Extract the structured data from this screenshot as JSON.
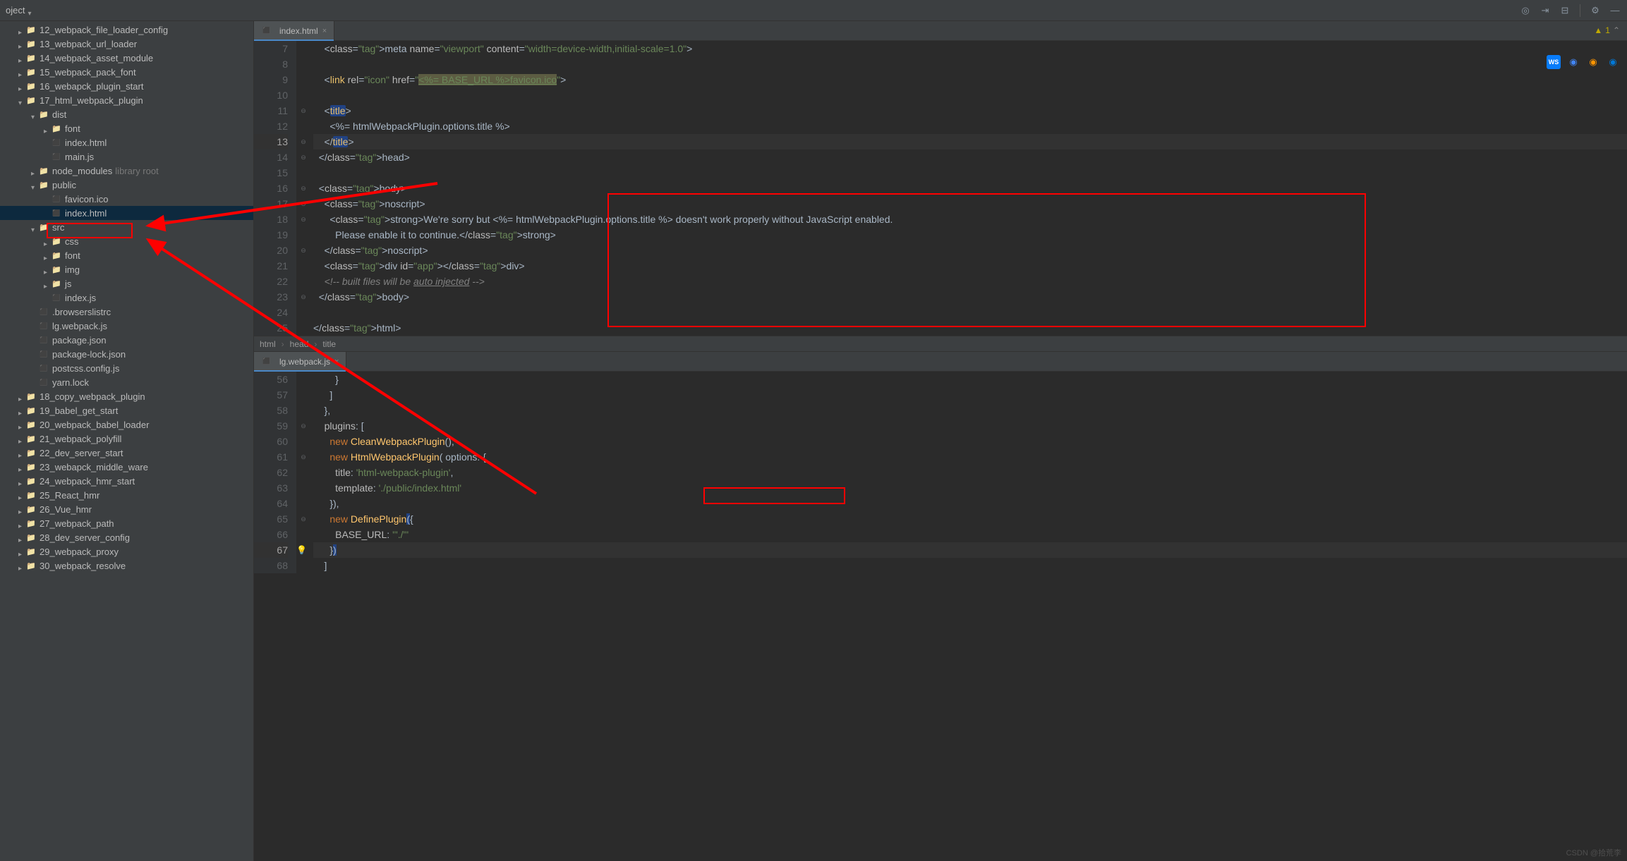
{
  "toolbar": {
    "title": "oject"
  },
  "tree": [
    {
      "d": 1,
      "ch": "r",
      "i": "folder",
      "t": "12_webpack_file_loader_config"
    },
    {
      "d": 1,
      "ch": "r",
      "i": "folder",
      "t": "13_webpack_url_loader"
    },
    {
      "d": 1,
      "ch": "r",
      "i": "folder",
      "t": "14_webpack_asset_module"
    },
    {
      "d": 1,
      "ch": "r",
      "i": "folder",
      "t": "15_webpack_pack_font"
    },
    {
      "d": 1,
      "ch": "r",
      "i": "folder",
      "t": "16_webapck_plugin_start"
    },
    {
      "d": 1,
      "ch": "d",
      "i": "folder",
      "t": "17_html_webpack_plugin"
    },
    {
      "d": 2,
      "ch": "d",
      "i": "folder",
      "t": "dist"
    },
    {
      "d": 3,
      "ch": "r",
      "i": "folder",
      "t": "font"
    },
    {
      "d": 3,
      "ch": "",
      "i": "file-html",
      "t": "index.html"
    },
    {
      "d": 3,
      "ch": "",
      "i": "file-js",
      "t": "main.js"
    },
    {
      "d": 2,
      "ch": "r",
      "i": "folder",
      "t": "node_modules",
      "hint": "library root"
    },
    {
      "d": 2,
      "ch": "d",
      "i": "folder",
      "t": "public"
    },
    {
      "d": 3,
      "ch": "",
      "i": "file-ico",
      "t": "favicon.ico"
    },
    {
      "d": 3,
      "ch": "",
      "i": "file-html",
      "t": "index.html",
      "sel": true
    },
    {
      "d": 2,
      "ch": "d",
      "i": "folder",
      "t": "src"
    },
    {
      "d": 3,
      "ch": "r",
      "i": "folder",
      "t": "css"
    },
    {
      "d": 3,
      "ch": "r",
      "i": "folder",
      "t": "font"
    },
    {
      "d": 3,
      "ch": "r",
      "i": "folder",
      "t": "img"
    },
    {
      "d": 3,
      "ch": "r",
      "i": "folder",
      "t": "js"
    },
    {
      "d": 3,
      "ch": "",
      "i": "file-js",
      "t": "index.js"
    },
    {
      "d": 2,
      "ch": "",
      "i": "file-generic",
      "t": ".browserslistrc"
    },
    {
      "d": 2,
      "ch": "",
      "i": "file-js",
      "t": "lg.webpack.js"
    },
    {
      "d": 2,
      "ch": "",
      "i": "file-json",
      "t": "package.json"
    },
    {
      "d": 2,
      "ch": "",
      "i": "file-json",
      "t": "package-lock.json"
    },
    {
      "d": 2,
      "ch": "",
      "i": "file-js",
      "t": "postcss.config.js"
    },
    {
      "d": 2,
      "ch": "",
      "i": "file-generic",
      "t": "yarn.lock"
    },
    {
      "d": 1,
      "ch": "r",
      "i": "folder",
      "t": "18_copy_webpack_plugin"
    },
    {
      "d": 1,
      "ch": "r",
      "i": "folder",
      "t": "19_babel_get_start"
    },
    {
      "d": 1,
      "ch": "r",
      "i": "folder",
      "t": "20_webpack_babel_loader"
    },
    {
      "d": 1,
      "ch": "r",
      "i": "folder",
      "t": "21_webpack_polyfill"
    },
    {
      "d": 1,
      "ch": "r",
      "i": "folder",
      "t": "22_dev_server_start"
    },
    {
      "d": 1,
      "ch": "r",
      "i": "folder",
      "t": "23_webapck_middle_ware"
    },
    {
      "d": 1,
      "ch": "r",
      "i": "folder",
      "t": "24_webpack_hmr_start"
    },
    {
      "d": 1,
      "ch": "r",
      "i": "folder",
      "t": "25_React_hmr"
    },
    {
      "d": 1,
      "ch": "r",
      "i": "folder",
      "t": "26_Vue_hmr"
    },
    {
      "d": 1,
      "ch": "r",
      "i": "folder",
      "t": "27_webpack_path"
    },
    {
      "d": 1,
      "ch": "r",
      "i": "folder",
      "t": "28_dev_server_config"
    },
    {
      "d": 1,
      "ch": "r",
      "i": "folder",
      "t": "29_webpack_proxy"
    },
    {
      "d": 1,
      "ch": "r",
      "i": "folder",
      "t": "30_webpack_resolve"
    }
  ],
  "tab1": {
    "label": "index.html"
  },
  "tab2": {
    "label": "lg.webpack.js"
  },
  "breadcrumb": [
    "html",
    "head",
    "title"
  ],
  "warn": {
    "count": "1"
  },
  "watermark": "CSDN @拾荒李",
  "e1": {
    "start": 7,
    "lines": [
      "    <meta name=\"viewport\" content=\"width=device-width,initial-scale=1.0\">",
      "",
      "    <link rel=\"icon\" href=\"<%= BASE_URL %>favicon.ico\">",
      "",
      "    <title>",
      "      <%= htmlWebpackPlugin.options.title %>",
      "    </title>",
      "  </head>",
      "",
      "  <body>",
      "    <noscript>",
      "      <strong>We're sorry but <%= htmlWebpackPlugin.options.title %> doesn't work properly without JavaScript enabled.",
      "        Please enable it to continue.</strong>",
      "    </noscript>",
      "    <div id=\"app\"></div>",
      "    <!-- built files will be auto injected -->",
      "  </body>",
      "",
      "</html>"
    ]
  },
  "e2": {
    "start": 56,
    "lines": [
      "        }",
      "      ]",
      "    },",
      "    plugins: [",
      "      new CleanWebpackPlugin(),",
      "      new HtmlWebpackPlugin( options: {",
      "        title: 'html-webpack-plugin',",
      "        template: './public/index.html'",
      "      }),",
      "      new DefinePlugin({",
      "        BASE_URL: '\"./\"'",
      "      })",
      "    ]"
    ]
  }
}
